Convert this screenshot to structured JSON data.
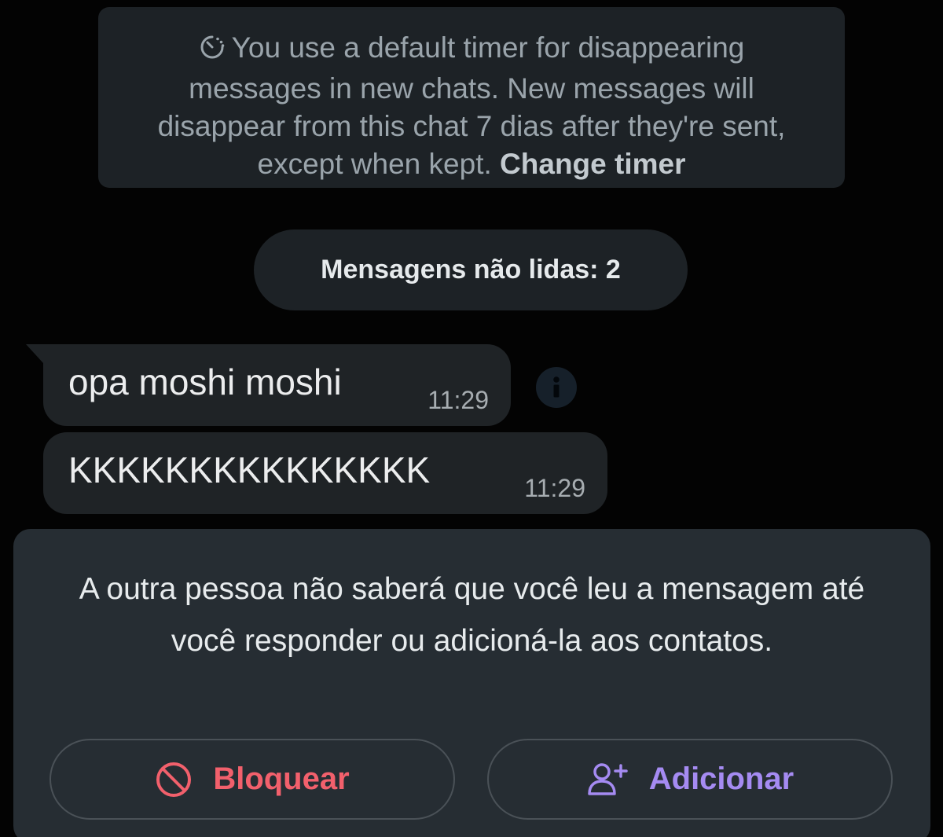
{
  "system_notice": {
    "icon": "timer-icon",
    "text": "You use a default timer for disappearing messages in new chats. New messages will disappear from this chat 7 dias after they're sent, except when kept.",
    "link_label": "Change timer"
  },
  "unread_banner": {
    "label": "Mensagens não lidas: 2"
  },
  "messages": [
    {
      "text": "opa moshi moshi",
      "time": "11:29"
    },
    {
      "text": "KKKKKKKKKKKKKKK",
      "time": "11:29"
    }
  ],
  "info_icon": "info-icon",
  "privacy_panel": {
    "text": "A outra pessoa não saberá que você leu a mensagem até você responder ou adicioná-la aos contatos.",
    "block_label": "Bloquear",
    "block_icon": "block-icon",
    "add_label": "Adicionar",
    "add_icon": "add-contact-icon"
  },
  "colors": {
    "block": "#f2606c",
    "add": "#a58bf2",
    "bubble": "#1f2326",
    "panel": "#262d33"
  }
}
